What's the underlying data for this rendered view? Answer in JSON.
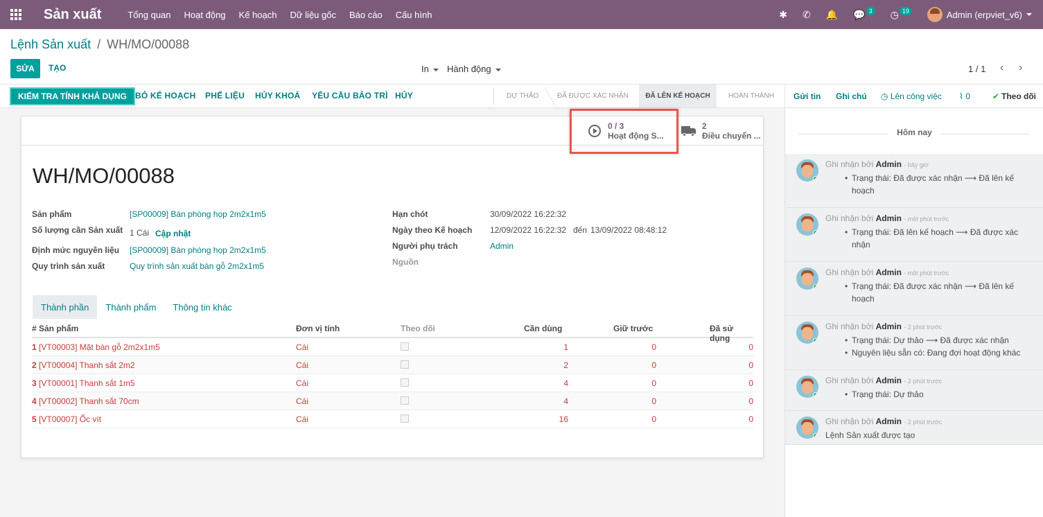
{
  "navbar": {
    "app_name": "Sản xuất",
    "menu": [
      "Tổng quan",
      "Hoạt động",
      "Kế hoạch",
      "Dữ liệu gốc",
      "Báo cáo",
      "Cấu hình"
    ],
    "messages_count": "3",
    "activities_count": "19",
    "user_name": "Admin (erpviet_v6)"
  },
  "control": {
    "breadcrumb_parent": "Lệnh Sản xuất",
    "breadcrumb_sep": "/",
    "breadcrumb_current": "WH/MO/00088",
    "edit_label": "SỬA",
    "create_label": "TẠO",
    "print_label": "In",
    "action_label": "Hành động",
    "pager": "1 / 1"
  },
  "statusbar": {
    "buttons": [
      "KIỂM TRA TÍNH KHẢ DỤNG",
      "BỎ KẾ HOẠCH",
      "PHẾ LIỆU",
      "HỦY KHOÁ",
      "YÊU CẦU BẢO TRÌ",
      "HỦY"
    ],
    "stages": [
      "DỰ THẢO",
      "ĐÃ ĐƯỢC XÁC NHẬN",
      "ĐÃ LÊN KẾ HOẠCH",
      "HOÀN THÀNH"
    ]
  },
  "smart_buttons": {
    "workorders_count": "0 / 3",
    "workorders_label": "Hoạt động S...",
    "transfers_count": "2",
    "transfers_label": "Điều chuyển ..."
  },
  "form": {
    "title": "WH/MO/00088",
    "product_label": "Sản phẩm",
    "product_value": "[SP00009] Bàn phòng họp 2m2x1m5",
    "qty_label": "Số lượng cần Sản xuất",
    "qty_value": "1 Cái",
    "qty_update": "Cập nhật",
    "bom_label": "Định mức nguyên liệu",
    "bom_value": "[SP00009] Bàn phòng họp 2m2x1m5",
    "routing_label": "Quy trình sản xuất",
    "routing_value": "Quy trình sản xuất bàn gỗ 2m2x1m5",
    "deadline_label": "Hạn chót",
    "deadline_value": "30/09/2022 16:22:32",
    "planned_label": "Ngày theo Kế hoạch",
    "planned_from": "12/09/2022 16:22:32",
    "planned_to_label": "đến",
    "planned_to": "13/09/2022 08:48:12",
    "responsible_label": "Người phụ trách",
    "responsible_value": "Admin",
    "source_label": "Nguồn"
  },
  "tabs": [
    "Thành phần",
    "Thành phẩm",
    "Thông tin khác"
  ],
  "table": {
    "headers": [
      "# Sản phẩm",
      "Đơn vị tính",
      "Theo dõi",
      "Cần dùng",
      "Giữ trước",
      "Đã sử dụng"
    ],
    "rows": [
      {
        "no": "1",
        "product": "[VT00003] Mặt bàn gỗ 2m2x1m5",
        "uom": "Cái",
        "needed": "1",
        "reserved": "0",
        "used": "0"
      },
      {
        "no": "2",
        "product": "[VT00004] Thanh sắt 2m2",
        "uom": "Cái",
        "needed": "2",
        "reserved": "0",
        "used": "0"
      },
      {
        "no": "3",
        "product": "[VT00001] Thanh sắt 1m5",
        "uom": "Cái",
        "needed": "4",
        "reserved": "0",
        "used": "0"
      },
      {
        "no": "4",
        "product": "[VT00002] Thanh sắt 70cm",
        "uom": "Cái",
        "needed": "4",
        "reserved": "0",
        "used": "0"
      },
      {
        "no": "5",
        "product": "[VT00007] Ốc vít",
        "uom": "Cái",
        "needed": "16",
        "reserved": "0",
        "used": "0"
      }
    ]
  },
  "chatter": {
    "send_message": "Gửi tin",
    "log_note": "Ghi chú",
    "schedule_activity": "Lên công việc",
    "attachments": "0",
    "follow": "Theo dõi",
    "today": "Hôm nay",
    "messages": [
      {
        "prefix": "Ghi nhận bởi",
        "author": "Admin",
        "time": "- bây giờ",
        "lines": [
          "Trạng thái: Đã được xác nhận ⟶ Đã lên kế hoạch"
        ]
      },
      {
        "prefix": "Ghi nhận bởi",
        "author": "Admin",
        "time": "- một phút trước",
        "lines": [
          "Trạng thái: Đã lên kế hoạch ⟶ Đã được xác nhận"
        ]
      },
      {
        "prefix": "Ghi nhận bởi",
        "author": "Admin",
        "time": "- một phút trước",
        "lines": [
          "Trạng thái: Đã được xác nhận ⟶ Đã lên kế hoạch"
        ]
      },
      {
        "prefix": "Ghi nhận bởi",
        "author": "Admin",
        "time": "- 2 phút trước",
        "lines": [
          "Trạng thái: Dự thảo ⟶ Đã được xác nhận",
          "Nguyên liệu sẵn có: Đang đợi hoạt động khác"
        ]
      },
      {
        "prefix": "Ghi nhận bởi",
        "author": "Admin",
        "time": "- 2 phút trước",
        "lines": [
          "Trạng thái: Dự thảo"
        ]
      },
      {
        "prefix": "Ghi nhận bởi",
        "author": "Admin",
        "time": "- 2 phút trước",
        "body": "Lệnh Sản xuất được tạo"
      }
    ]
  }
}
